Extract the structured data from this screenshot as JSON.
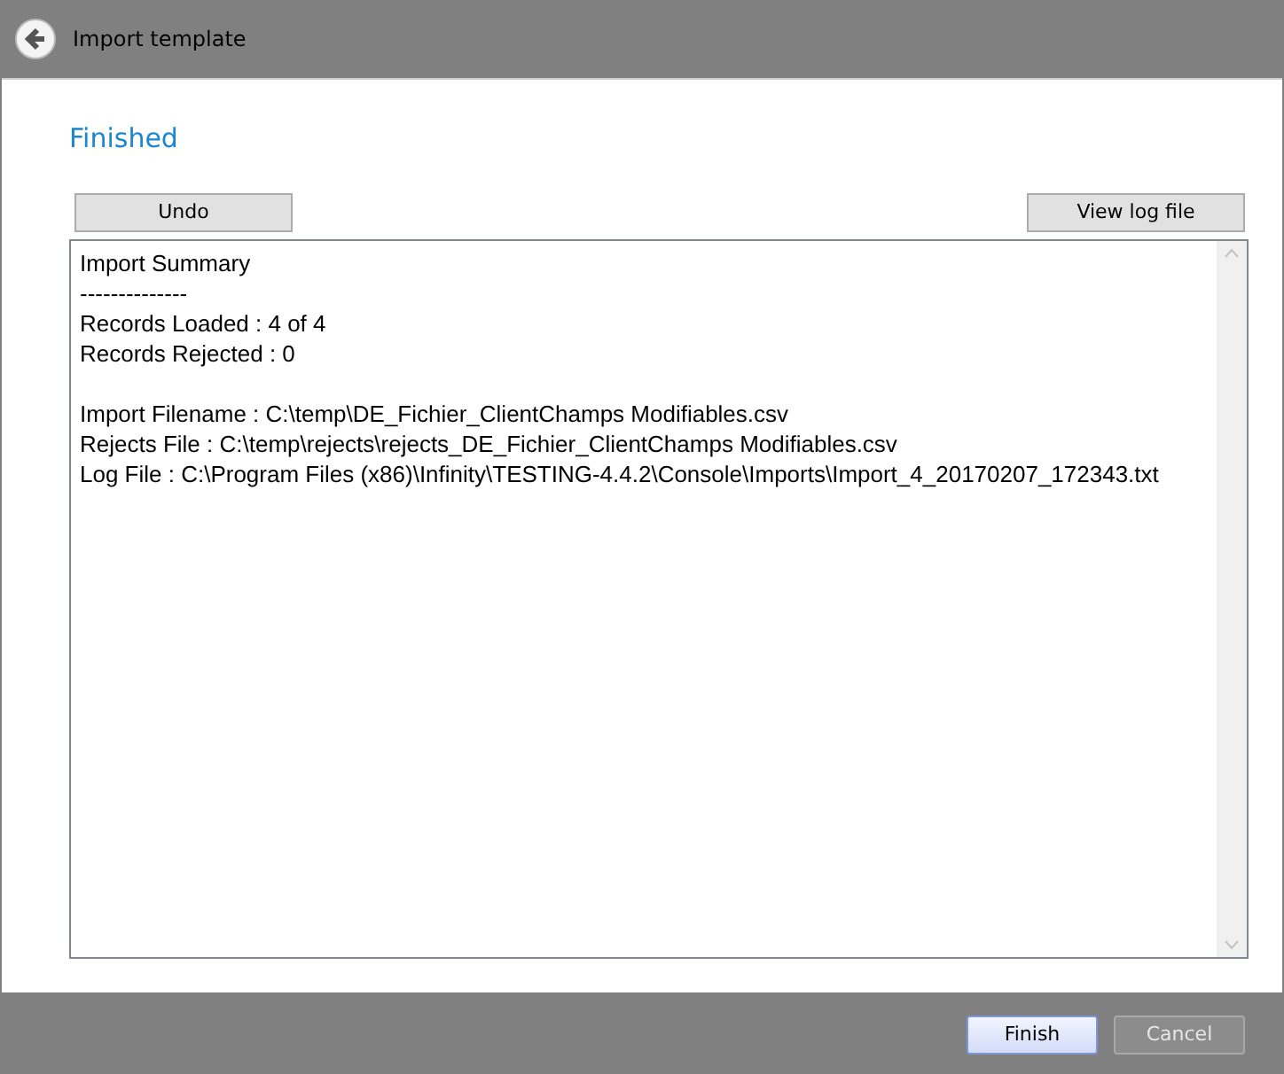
{
  "window": {
    "title": "Import template"
  },
  "heading": "Finished",
  "toolbar": {
    "left_button": "Undo",
    "right_button": "View log file"
  },
  "log_blocks": [
    [
      "Import Summary",
      "--------------",
      "Records Loaded : 4 of 4",
      "Records Rejected : 0"
    ],
    [
      "Import Filename : C:\\temp\\DE_Fichier_ClientChamps Modifiables.csv",
      "Rejects File : C:\\temp\\rejects\\rejects_DE_Fichier_ClientChamps Modifiables.csv",
      "Log File : C:\\Program Files (x86)\\Infinity\\TESTING-4.4.2\\Console\\Imports\\Import_4_20170207_172343.txt"
    ]
  ],
  "footer_buttons": [
    {
      "label": "Finish",
      "disabled": false
    },
    {
      "label": "Cancel",
      "disabled": true
    }
  ]
}
